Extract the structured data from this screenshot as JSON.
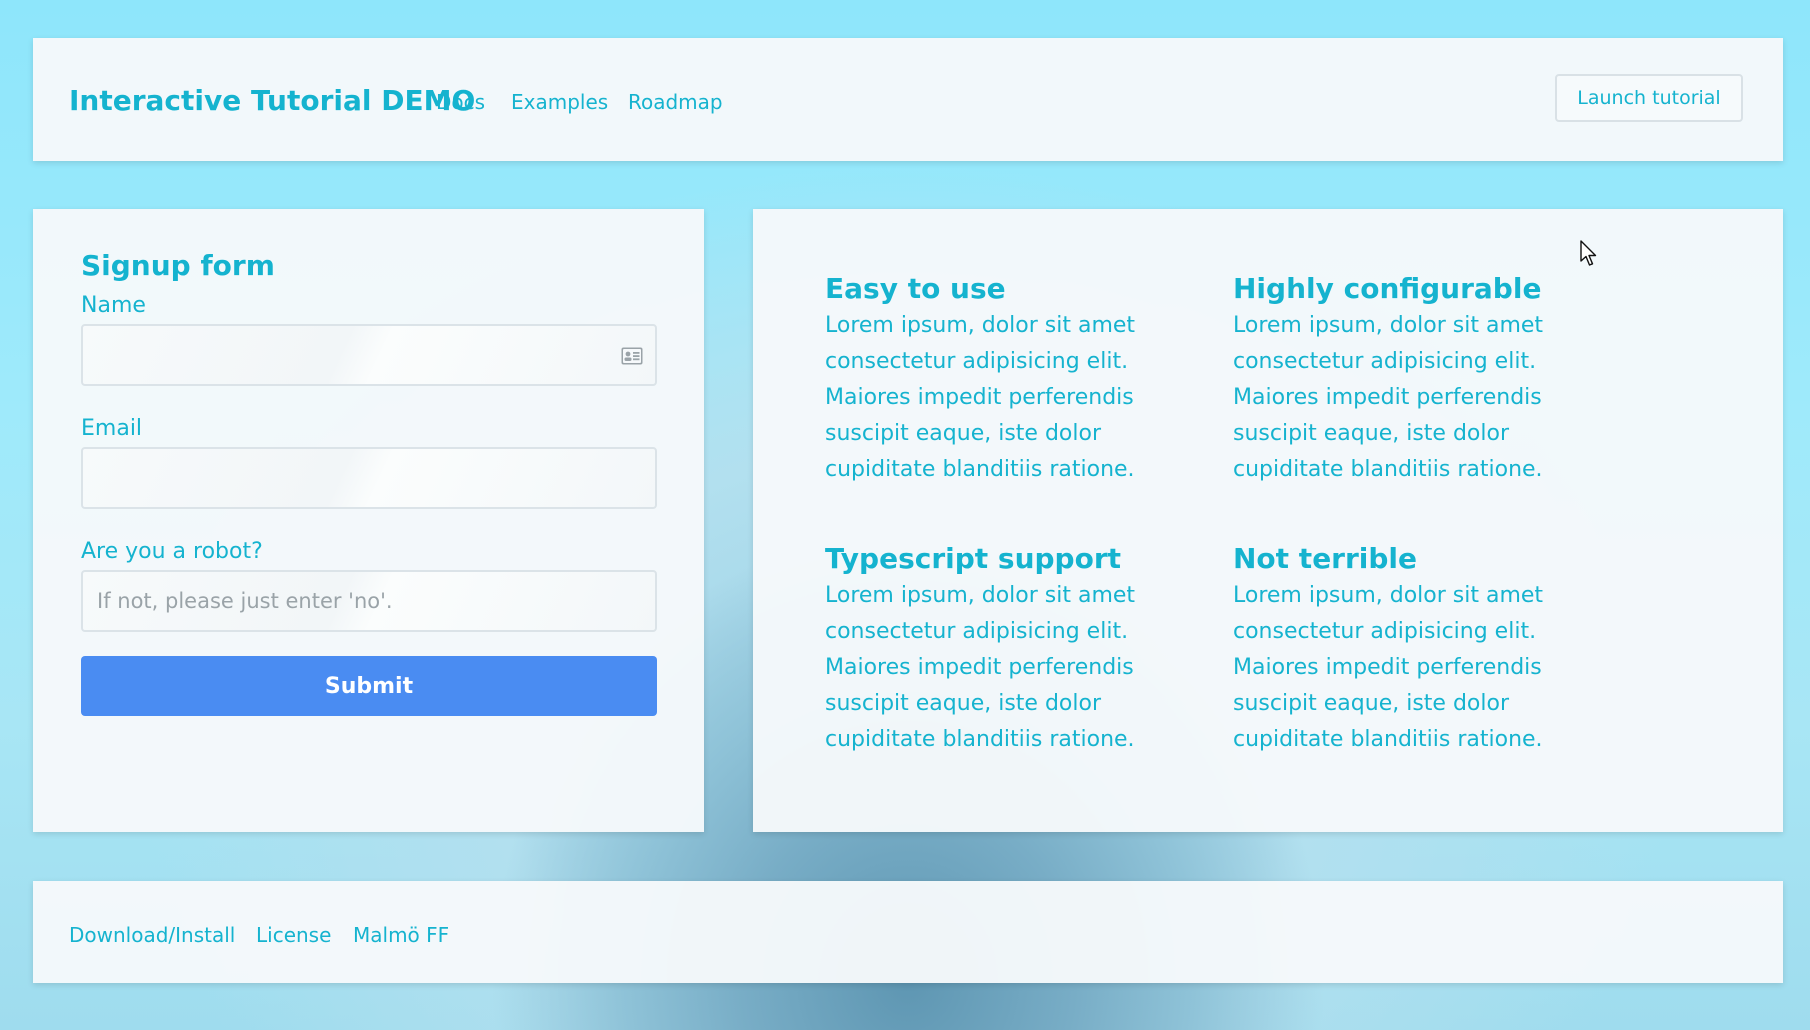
{
  "header": {
    "brand": "Interactive Tutorial DEMO",
    "nav": [
      "Docs",
      "Examples",
      "Roadmap"
    ],
    "launch_label": "Launch tutorial"
  },
  "form": {
    "title": "Signup form",
    "name_label": "Name",
    "name_icon": "contact-card-icon",
    "email_label": "Email",
    "robot_label": "Are you a robot?",
    "robot_placeholder": "If not, please just enter 'no'.",
    "submit_label": "Submit"
  },
  "features": [
    {
      "title": "Easy to use",
      "body": "Lorem ipsum, dolor sit amet consectetur adipisicing elit. Maiores impedit perferendis suscipit eaque, iste dolor cupiditate blanditiis ratione."
    },
    {
      "title": "Highly configurable",
      "body": "Lorem ipsum, dolor sit amet consectetur adipisicing elit. Maiores impedit perferendis suscipit eaque, iste dolor cupiditate blanditiis ratione."
    },
    {
      "title": "Typescript support",
      "body": "Lorem ipsum, dolor sit amet consectetur adipisicing elit. Maiores impedit perferendis suscipit eaque, iste dolor cupiditate blanditiis ratione."
    },
    {
      "title": "Not terrible",
      "body": "Lorem ipsum, dolor sit amet consectetur adipisicing elit. Maiores impedit perferendis suscipit eaque, iste dolor cupiditate blanditiis ratione."
    }
  ],
  "footer": {
    "links": [
      "Download/Install",
      "License",
      "Malmö FF"
    ]
  },
  "colors": {
    "accent": "#15b3cf",
    "submit": "#4a8cf2",
    "panel": "#f6f9fb"
  }
}
